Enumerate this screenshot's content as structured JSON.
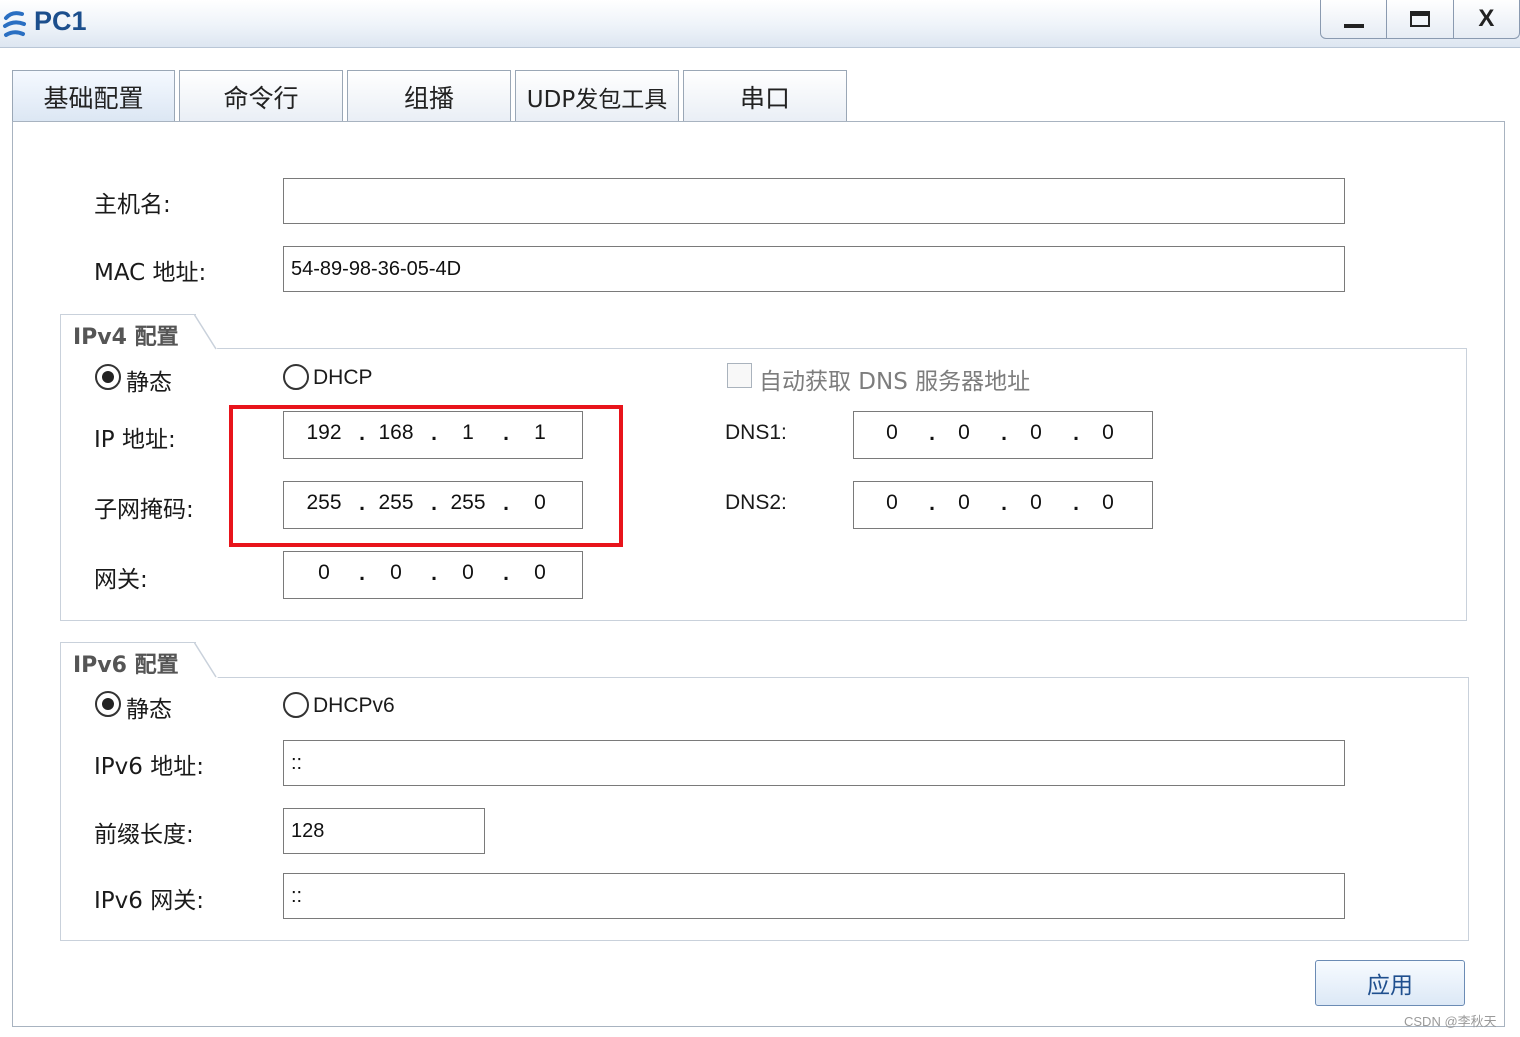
{
  "window": {
    "title": "PC1",
    "buttons": {
      "minimize": "minimize",
      "maximize": "maximize",
      "close": "X"
    }
  },
  "tabs": [
    {
      "label": "基础配置",
      "active": true
    },
    {
      "label": "命令行",
      "active": false
    },
    {
      "label": "组播",
      "active": false
    },
    {
      "label": "UDP发包工具",
      "active": false
    },
    {
      "label": "串口",
      "active": false
    }
  ],
  "basic": {
    "hostname_label": "主机名:",
    "hostname_value": "",
    "mac_label": "MAC 地址:",
    "mac_value": "54-89-98-36-05-4D"
  },
  "ipv4": {
    "group_title": "IPv4 配置",
    "static_label": "静态",
    "dhcp_label": "DHCP",
    "mode": "static",
    "auto_dns_label": "自动获取 DNS 服务器地址",
    "auto_dns_checked": false,
    "ip_label": "IP 地址:",
    "ip": [
      "192",
      "168",
      "1",
      "1"
    ],
    "mask_label": "子网掩码:",
    "mask": [
      "255",
      "255",
      "255",
      "0"
    ],
    "gateway_label": "网关:",
    "gateway": [
      "0",
      "0",
      "0",
      "0"
    ],
    "dns1_label": "DNS1:",
    "dns1": [
      "0",
      "0",
      "0",
      "0"
    ],
    "dns2_label": "DNS2:",
    "dns2": [
      "0",
      "0",
      "0",
      "0"
    ]
  },
  "ipv6": {
    "group_title": "IPv6 配置",
    "static_label": "静态",
    "dhcp_label": "DHCPv6",
    "mode": "static",
    "address_label": "IPv6 地址:",
    "address_value": "::",
    "prefix_label": "前缀长度:",
    "prefix_value": "128",
    "gateway_label": "IPv6 网关:",
    "gateway_value": "::"
  },
  "apply_label": "应用",
  "watermark": "CSDN @李秋天",
  "colors": {
    "title_text": "#1c4f8d",
    "highlight_box": "#e8141b",
    "apply_text": "#1f4f8e"
  },
  "icons": {
    "app": "ensp-pc-icon",
    "minimize": "minimize-icon",
    "maximize": "maximize-icon",
    "close": "close-icon"
  }
}
